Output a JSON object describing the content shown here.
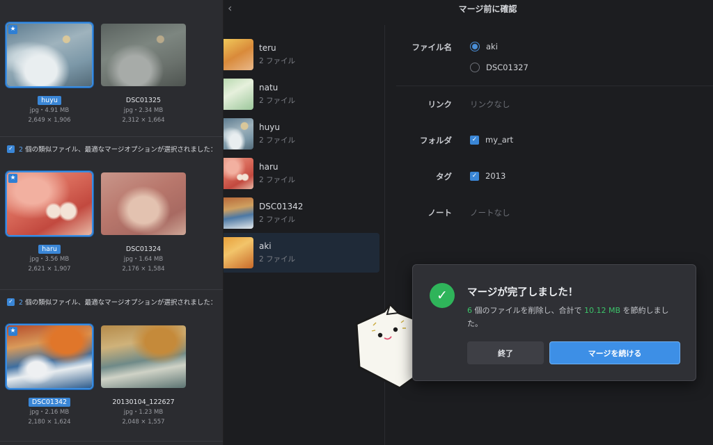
{
  "groups": [
    {
      "header": null,
      "selected": {
        "name": "huyu",
        "meta1": "jpg・4.91 MB",
        "meta2": "2,649 × 1,906",
        "art": "art-winter"
      },
      "other": {
        "name": "DSC01325",
        "meta1": "jpg・2.34 MB",
        "meta2": "2,312 × 1,664",
        "art": "art-winter-dim"
      }
    },
    {
      "header": {
        "count": "2",
        "text": " 個の類似ファイル、最適なマージオプションが選択されました："
      },
      "selected": {
        "name": "haru",
        "meta1": "jpg・3.56 MB",
        "meta2": "2,621 × 1,907",
        "art": "art-haru"
      },
      "other": {
        "name": "DSC01324",
        "meta1": "jpg・1.64 MB",
        "meta2": "2,176 × 1,584",
        "art": "art-haru-dim"
      }
    },
    {
      "header": {
        "count": "2",
        "text": " 個の類似ファイル、最適なマージオプションが選択されました："
      },
      "selected": {
        "name": "DSC01342",
        "meta1": "jpg・2.16 MB",
        "meta2": "2,180 × 1,624",
        "art": "art-wave"
      },
      "other": {
        "name": "20130104_122627",
        "meta1": "jpg・1.23 MB",
        "meta2": "2,048 × 1,557",
        "art": "art-wave-dim"
      }
    }
  ],
  "topbar": {
    "title": "マージ前に確認"
  },
  "files": [
    {
      "name": "teru",
      "count": "2 ファイル",
      "art": "art-teru",
      "active": false
    },
    {
      "name": "natu",
      "count": "2 ファイル",
      "art": "art-natu",
      "active": false
    },
    {
      "name": "huyu",
      "count": "2 ファイル",
      "art": "art-winter",
      "active": false
    },
    {
      "name": "haru",
      "count": "2 ファイル",
      "art": "art-haru",
      "active": false
    },
    {
      "name": "DSC01342",
      "count": "2 ファイル",
      "art": "art-dsc342",
      "active": false
    },
    {
      "name": "aki",
      "count": "2 ファイル",
      "art": "art-aki",
      "active": true
    }
  ],
  "detail": {
    "filename_label": "ファイル名",
    "filename_options": [
      {
        "label": "aki",
        "selected": true
      },
      {
        "label": "DSC01327",
        "selected": false
      }
    ],
    "link_label": "リンク",
    "link_value": "リンクなし",
    "folder_label": "フォルダ",
    "folder_value": "my_art",
    "tag_label": "タグ",
    "tag_value": "2013",
    "note_label": "ノート",
    "note_value": "ノートなし"
  },
  "modal": {
    "title": "マージが完了しました！",
    "deleted_count": "6",
    "msg_part1": " 個のファイルを削除し、合計で ",
    "saved": "10.12 MB",
    "msg_part2": " を節約しました。",
    "finish_label": "終了",
    "continue_label": "マージを続ける"
  },
  "colors": {
    "accent": "#3d8fe6",
    "success": "#2fb45a",
    "panel": "#2b2c30",
    "background": "#1c1d20"
  }
}
